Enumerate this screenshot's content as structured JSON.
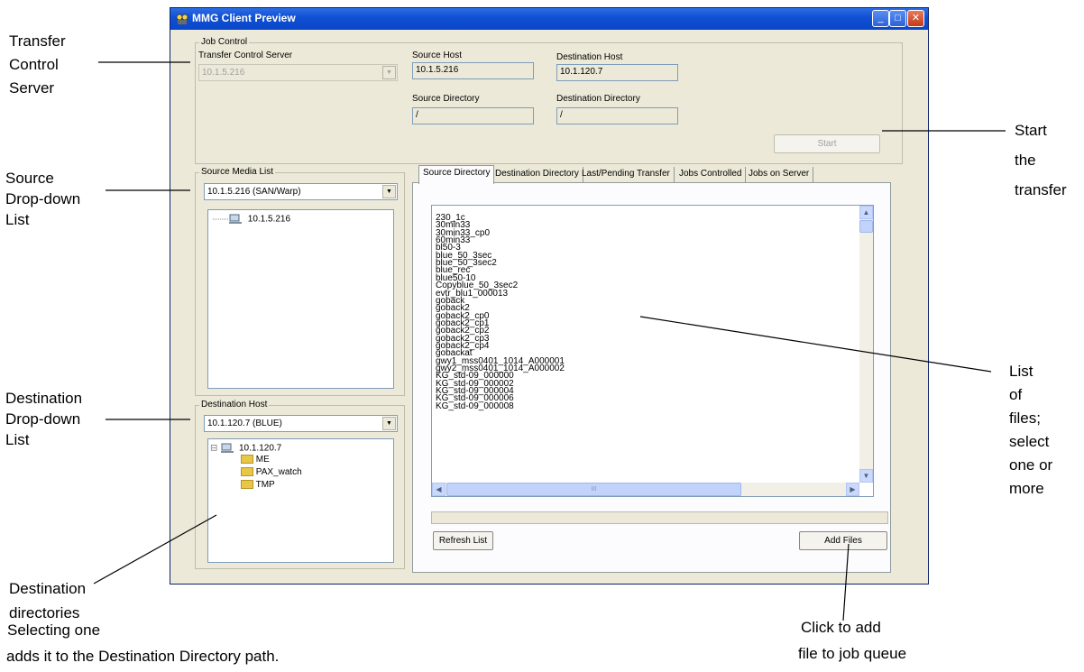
{
  "annotations": {
    "tcs": [
      "Transfer",
      "Control",
      "Server"
    ],
    "source_dd": [
      "Source",
      "Drop-down",
      "List"
    ],
    "dest_dd": [
      "Destination",
      "Drop-down",
      "List"
    ],
    "dest_dirs": [
      "Destination",
      "directories"
    ],
    "selecting": [
      "Selecting one",
      "adds it to the Destination Directory path."
    ],
    "start": [
      "Start",
      "the",
      "transfer"
    ],
    "list": [
      "List",
      "of",
      "files;",
      "select",
      "one or",
      "more"
    ],
    "click": [
      "Click to add",
      "file to job queue"
    ]
  },
  "window": {
    "title": "MMG Client Preview",
    "minimize": "_",
    "maximize": "□",
    "close": "✕"
  },
  "job_control": {
    "legend": "Job Control",
    "tcs_label": "Transfer Control Server",
    "tcs_value": "10.1.5.216",
    "source_host_label": "Source Host",
    "source_host_value": "10.1.5.216",
    "dest_host_label": "Destination Host",
    "dest_host_value": "10.1.120.7",
    "source_dir_label": "Source Directory",
    "source_dir_value": "/",
    "dest_dir_label": "Destination Directory",
    "dest_dir_value": "/",
    "start_button": "Start"
  },
  "source_media": {
    "legend": "Source Media List",
    "selected": "10.1.5.216 (SAN/Warp)",
    "tree_root": "10.1.5.216"
  },
  "destination_host": {
    "legend": "Destination Host",
    "selected": "10.1.120.7 (BLUE)",
    "tree_root": "10.1.120.7",
    "expander": "⊟",
    "folders": [
      "ME",
      "PAX_watch",
      "TMP"
    ]
  },
  "tabs": [
    "Source Directory",
    "Destination Directory",
    "Last/Pending Transfer",
    "Jobs Controlled",
    "Jobs on Server"
  ],
  "files": [
    "230_1c",
    "30min33",
    "30min33_cp0",
    "60min33",
    "bl50-3",
    "blue_50_3sec",
    "blue_50_3sec2",
    "blue_rec",
    "blue50-10",
    "Copyblue_50_3sec2",
    "evtr_blu1_000013",
    "goback",
    "goback2",
    "goback2_cp0",
    "goback2_cp1",
    "goback2_cp2",
    "goback2_cp3",
    "goback2_cp4",
    "gobackat",
    "gwy1_mss0401_1014_A000001",
    "gwy2_mss0401_1014_A000002",
    "KG_std-09_000000",
    "KG_std-09_000002",
    "KG_std-09_000004",
    "KG_std-09_000006",
    "KG_std-09_000008"
  ],
  "buttons": {
    "refresh": "Refresh List",
    "add_files": "Add Files"
  },
  "scroll": {
    "up": "▲",
    "down": "▼",
    "left": "◀",
    "right": "▶",
    "grip": "III",
    "combo_arrow": "▼"
  }
}
